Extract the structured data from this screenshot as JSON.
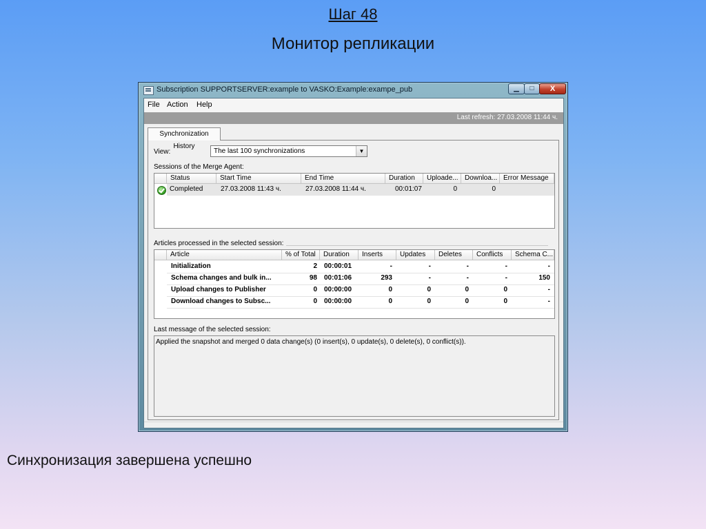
{
  "slide": {
    "step": "Шаг 48",
    "title": "Монитор репликации",
    "caption": "Синхронизация завершена успешно"
  },
  "window": {
    "title": "Subscription SUPPORTSERVER:example to VASKO:Example:exampe_pub",
    "controls": {
      "minimize": "▁",
      "maximize": "□",
      "close": "X"
    }
  },
  "menu": {
    "file": "File",
    "action": "Action",
    "help": "Help"
  },
  "refresh": "Last refresh: 27.03.2008 11:44 ч.",
  "tab": "Synchronization History",
  "view": {
    "label": "View:",
    "selected": "The last 100 synchronizations"
  },
  "sessions": {
    "label": "Sessions of the Merge Agent:",
    "columns": [
      "Status",
      "Start Time",
      "End Time",
      "Duration",
      "Uploade...",
      "Downloa...",
      "Error Message"
    ],
    "rows": [
      {
        "status": "Completed",
        "start": "27.03.2008 11:43 ч.",
        "end": "27.03.2008 11:44 ч.",
        "duration": "00:01:07",
        "uploaded": "0",
        "downloaded": "0",
        "error": ""
      }
    ]
  },
  "articles": {
    "label": "Articles processed in the selected session:",
    "columns": [
      "Article",
      "% of Total",
      "Duration",
      "Inserts",
      "Updates",
      "Deletes",
      "Conflicts",
      "Schema C..."
    ],
    "rows": [
      {
        "article": "Initialization",
        "pct": "2",
        "duration": "00:00:01",
        "inserts": "-",
        "updates": "-",
        "deletes": "-",
        "conflicts": "-",
        "schema": "-"
      },
      {
        "article": "Schema changes and bulk in...",
        "pct": "98",
        "duration": "00:01:06",
        "inserts": "293",
        "updates": "-",
        "deletes": "-",
        "conflicts": "-",
        "schema": "150"
      },
      {
        "article": "Upload changes to Publisher",
        "pct": "0",
        "duration": "00:00:00",
        "inserts": "0",
        "updates": "0",
        "deletes": "0",
        "conflicts": "0",
        "schema": "-"
      },
      {
        "article": "Download changes to Subsc...",
        "pct": "0",
        "duration": "00:00:00",
        "inserts": "0",
        "updates": "0",
        "deletes": "0",
        "conflicts": "0",
        "schema": "-"
      }
    ]
  },
  "last_message": {
    "label": "Last message of the selected session:",
    "text": "Applied the snapshot and merged 0 data change(s) (0 insert(s), 0 update(s), 0 delete(s), 0 conflict(s))."
  },
  "colors": {
    "refresh_bar": "#9c9c9c",
    "status_ok": "#2f9a1f"
  }
}
